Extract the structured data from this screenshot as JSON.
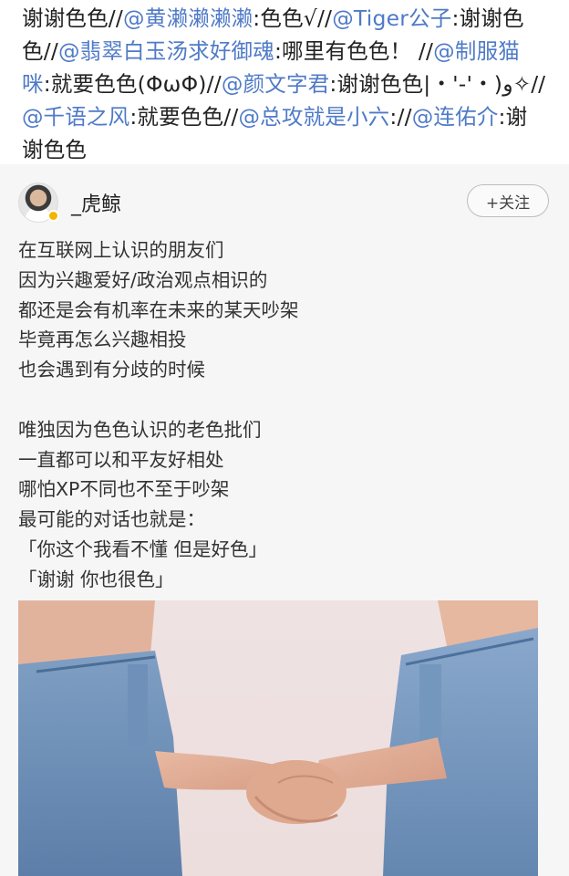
{
  "repost_chain": [
    {
      "text": "谢谢色色//",
      "mention": false
    },
    {
      "text": "@黄濑濑濑濑",
      "mention": true
    },
    {
      "text": ":色色√//",
      "mention": false
    },
    {
      "text": "@Tiger公子",
      "mention": true
    },
    {
      "text": ":谢谢色色//",
      "mention": false
    },
    {
      "text": "@翡翠白玉汤求好御魂",
      "mention": true
    },
    {
      "text": ":哪里有色色！ //",
      "mention": false
    },
    {
      "text": "@制服猫咪",
      "mention": true
    },
    {
      "text": ":就要色色(ΦωΦ)//",
      "mention": false
    },
    {
      "text": "@颜文字君",
      "mention": true
    },
    {
      "text": ":谢谢色色|・'-'・)و✧//",
      "mention": false
    },
    {
      "text": "@千语之风",
      "mention": true
    },
    {
      "text": ":就要色色//",
      "mention": false
    },
    {
      "text": "@总攻就是小六",
      "mention": true
    },
    {
      "text": "://",
      "mention": false
    },
    {
      "text": "@连佑介",
      "mention": true
    },
    {
      "text": ":谢谢色色",
      "mention": false
    }
  ],
  "post": {
    "author": "_虎鲸",
    "follow_label": "+关注",
    "paragraph1": [
      "在互联网上认识的朋友们",
      "因为兴趣爱好/政治观点相识的",
      "都还是会有机率在未来的某天吵架",
      "毕竟再怎么兴趣相投",
      "也会遇到有分歧的时候"
    ],
    "paragraph2": [
      "唯独因为色色认识的老色批们",
      "一直都可以和平友好相处",
      "哪怕XP不同也不至于吵架",
      "最可能的对话也就是：",
      "「你这个我看不懂 但是好色」",
      "「谢谢 你也很色」"
    ]
  },
  "colors": {
    "mention": "#4f7ac7",
    "card_bg": "#f6f6f6",
    "verified_badge": "#f5b400"
  }
}
